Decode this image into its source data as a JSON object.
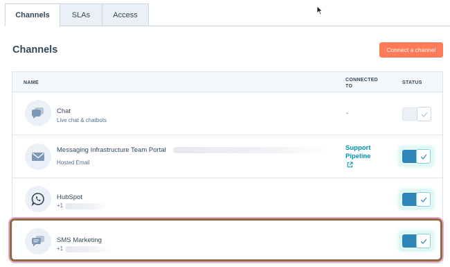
{
  "tabs": [
    {
      "label": "Channels",
      "active": true
    },
    {
      "label": "SLAs",
      "active": false
    },
    {
      "label": "Access",
      "active": false
    }
  ],
  "page": {
    "title": "Channels",
    "connect_button": "Connect a channel"
  },
  "table": {
    "headers": {
      "name": "NAME",
      "connected_to": "CONNECTED TO",
      "status": "STATUS"
    },
    "rows": [
      {
        "name": "Chat",
        "subtitle": "Live chat & chatbots",
        "connected_to": "-",
        "status_on": false,
        "icon": "chat-bubble-icon"
      },
      {
        "name": "Messaging Infrastructure Team Portal",
        "subtitle": "Hosted Email",
        "connected_link": "Support Pipeline",
        "status_on": true,
        "icon": "envelope-icon"
      },
      {
        "name": "HubSpot",
        "subtitle": "+1",
        "status_on": true,
        "icon": "whatsapp-icon"
      },
      {
        "name": "SMS Marketing",
        "subtitle": "+1",
        "status_on": true,
        "icon": "sms-chat-icon"
      }
    ]
  },
  "colors": {
    "accent": "#ff7a59",
    "toggle_on": "#2e86b8",
    "link": "#0091ae",
    "highlight_border": "#8b6a45"
  }
}
